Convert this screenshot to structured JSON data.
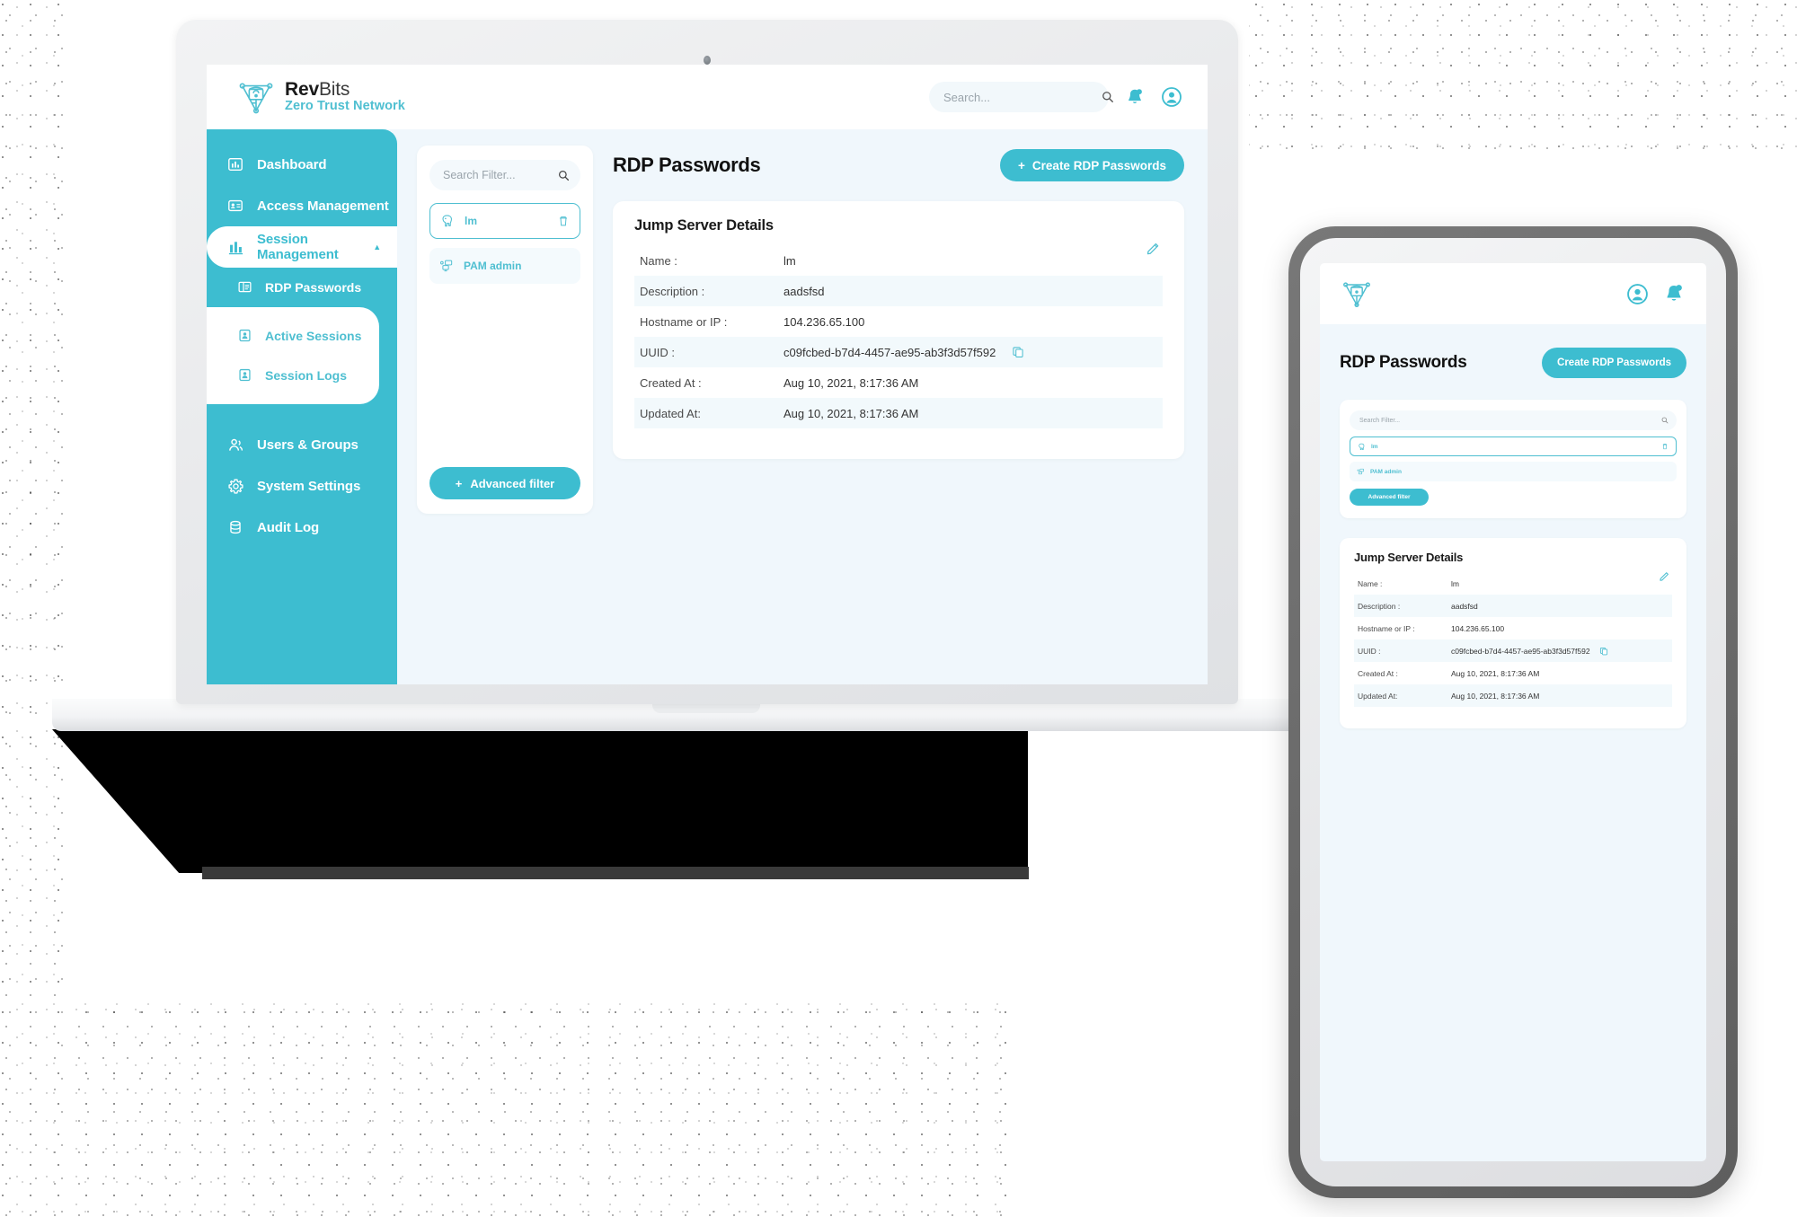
{
  "brand": {
    "name_bold": "Rev",
    "name_light": "Bits",
    "tagline": "Zero Trust Network"
  },
  "topbar": {
    "search_placeholder": "Search...",
    "search_value": "",
    "notifications_icon": "bell-icon",
    "account_icon": "user-circle-icon"
  },
  "sidebar": {
    "items": [
      {
        "label": "Dashboard",
        "icon": "chart-bar-icon",
        "active": false
      },
      {
        "label": "Access Management",
        "icon": "id-card-icon",
        "active": false
      },
      {
        "label": "Session Management",
        "icon": "bar-chart-icon",
        "active": true,
        "expanded": true
      },
      {
        "label": "Users & Groups",
        "icon": "users-icon",
        "active": false
      },
      {
        "label": "System Settings",
        "icon": "gear-icon",
        "active": false
      },
      {
        "label": "Audit Log",
        "icon": "database-icon",
        "active": false
      }
    ],
    "subitems_teal": [
      {
        "label": "RDP Passwords",
        "icon": "window-panes-icon"
      }
    ],
    "subitems_white": [
      {
        "label": "Active Sessions",
        "icon": "user-badge-icon"
      },
      {
        "label": "Session Logs",
        "icon": "user-badge-icon"
      }
    ]
  },
  "filter_panel": {
    "search_placeholder": "Search Filter...",
    "search_value": "",
    "items": [
      {
        "label": "lm",
        "icon": "elephant-db-icon",
        "selected": true,
        "has_delete": true
      },
      {
        "label": "PAM admin",
        "icon": "network-nodes-icon",
        "selected": false,
        "has_delete": false
      }
    ],
    "advanced_filter_label": "Advanced filter",
    "advanced_filter_plus": "+"
  },
  "main": {
    "page_title": "RDP Passwords",
    "create_button_label": "Create RDP Passwords",
    "create_button_plus": "+"
  },
  "detail_card": {
    "title": "Jump Server Details",
    "edit_icon": "pencil-icon",
    "copy_icon": "copy-icon",
    "rows": [
      {
        "label": "Name :",
        "value": "lm",
        "copyable": false
      },
      {
        "label": "Description :",
        "value": "aadsfsd",
        "copyable": false
      },
      {
        "label": "Hostname or IP :",
        "value": "104.236.65.100",
        "copyable": false
      },
      {
        "label": "UUID :",
        "value": "c09fcbed-b7d4-4457-ae95-ab3f3d57f592",
        "copyable": true
      },
      {
        "label": "Created At :",
        "value": "Aug 10, 2021, 8:17:36 AM",
        "copyable": false
      },
      {
        "label": "Updated At:",
        "value": "Aug 10, 2021, 8:17:36 AM",
        "copyable": false
      }
    ]
  },
  "tablet": {
    "page_title": "RDP Passwords",
    "create_button_label": "Create RDP Passwords",
    "search_placeholder": "Search Filter...",
    "items": [
      {
        "label": "lm",
        "selected": true
      },
      {
        "label": "PAM admin",
        "selected": false
      }
    ],
    "advanced_filter_label": "Advanced filter",
    "detail_title": "Jump Server Details",
    "rows": [
      {
        "label": "Name :",
        "value": "lm",
        "copyable": false
      },
      {
        "label": "Description :",
        "value": "aadsfsd",
        "copyable": false
      },
      {
        "label": "Hostname or IP :",
        "value": "104.236.65.100",
        "copyable": false
      },
      {
        "label": "UUID :",
        "value": "c09fcbed-b7d4-4457-ae95-ab3f3d57f592",
        "copyable": true
      },
      {
        "label": "Created At :",
        "value": "Aug 10, 2021, 8:17:36 AM",
        "copyable": false
      },
      {
        "label": "Updated At:",
        "value": "Aug 10, 2021, 8:17:36 AM",
        "copyable": false
      }
    ]
  },
  "colors": {
    "teal": "#3DBDD0",
    "teal_light": "#4FBFD1",
    "page_bg": "#F0F7FC",
    "card_bg": "#FFFFFF",
    "row_alt": "#F2F9FC"
  }
}
